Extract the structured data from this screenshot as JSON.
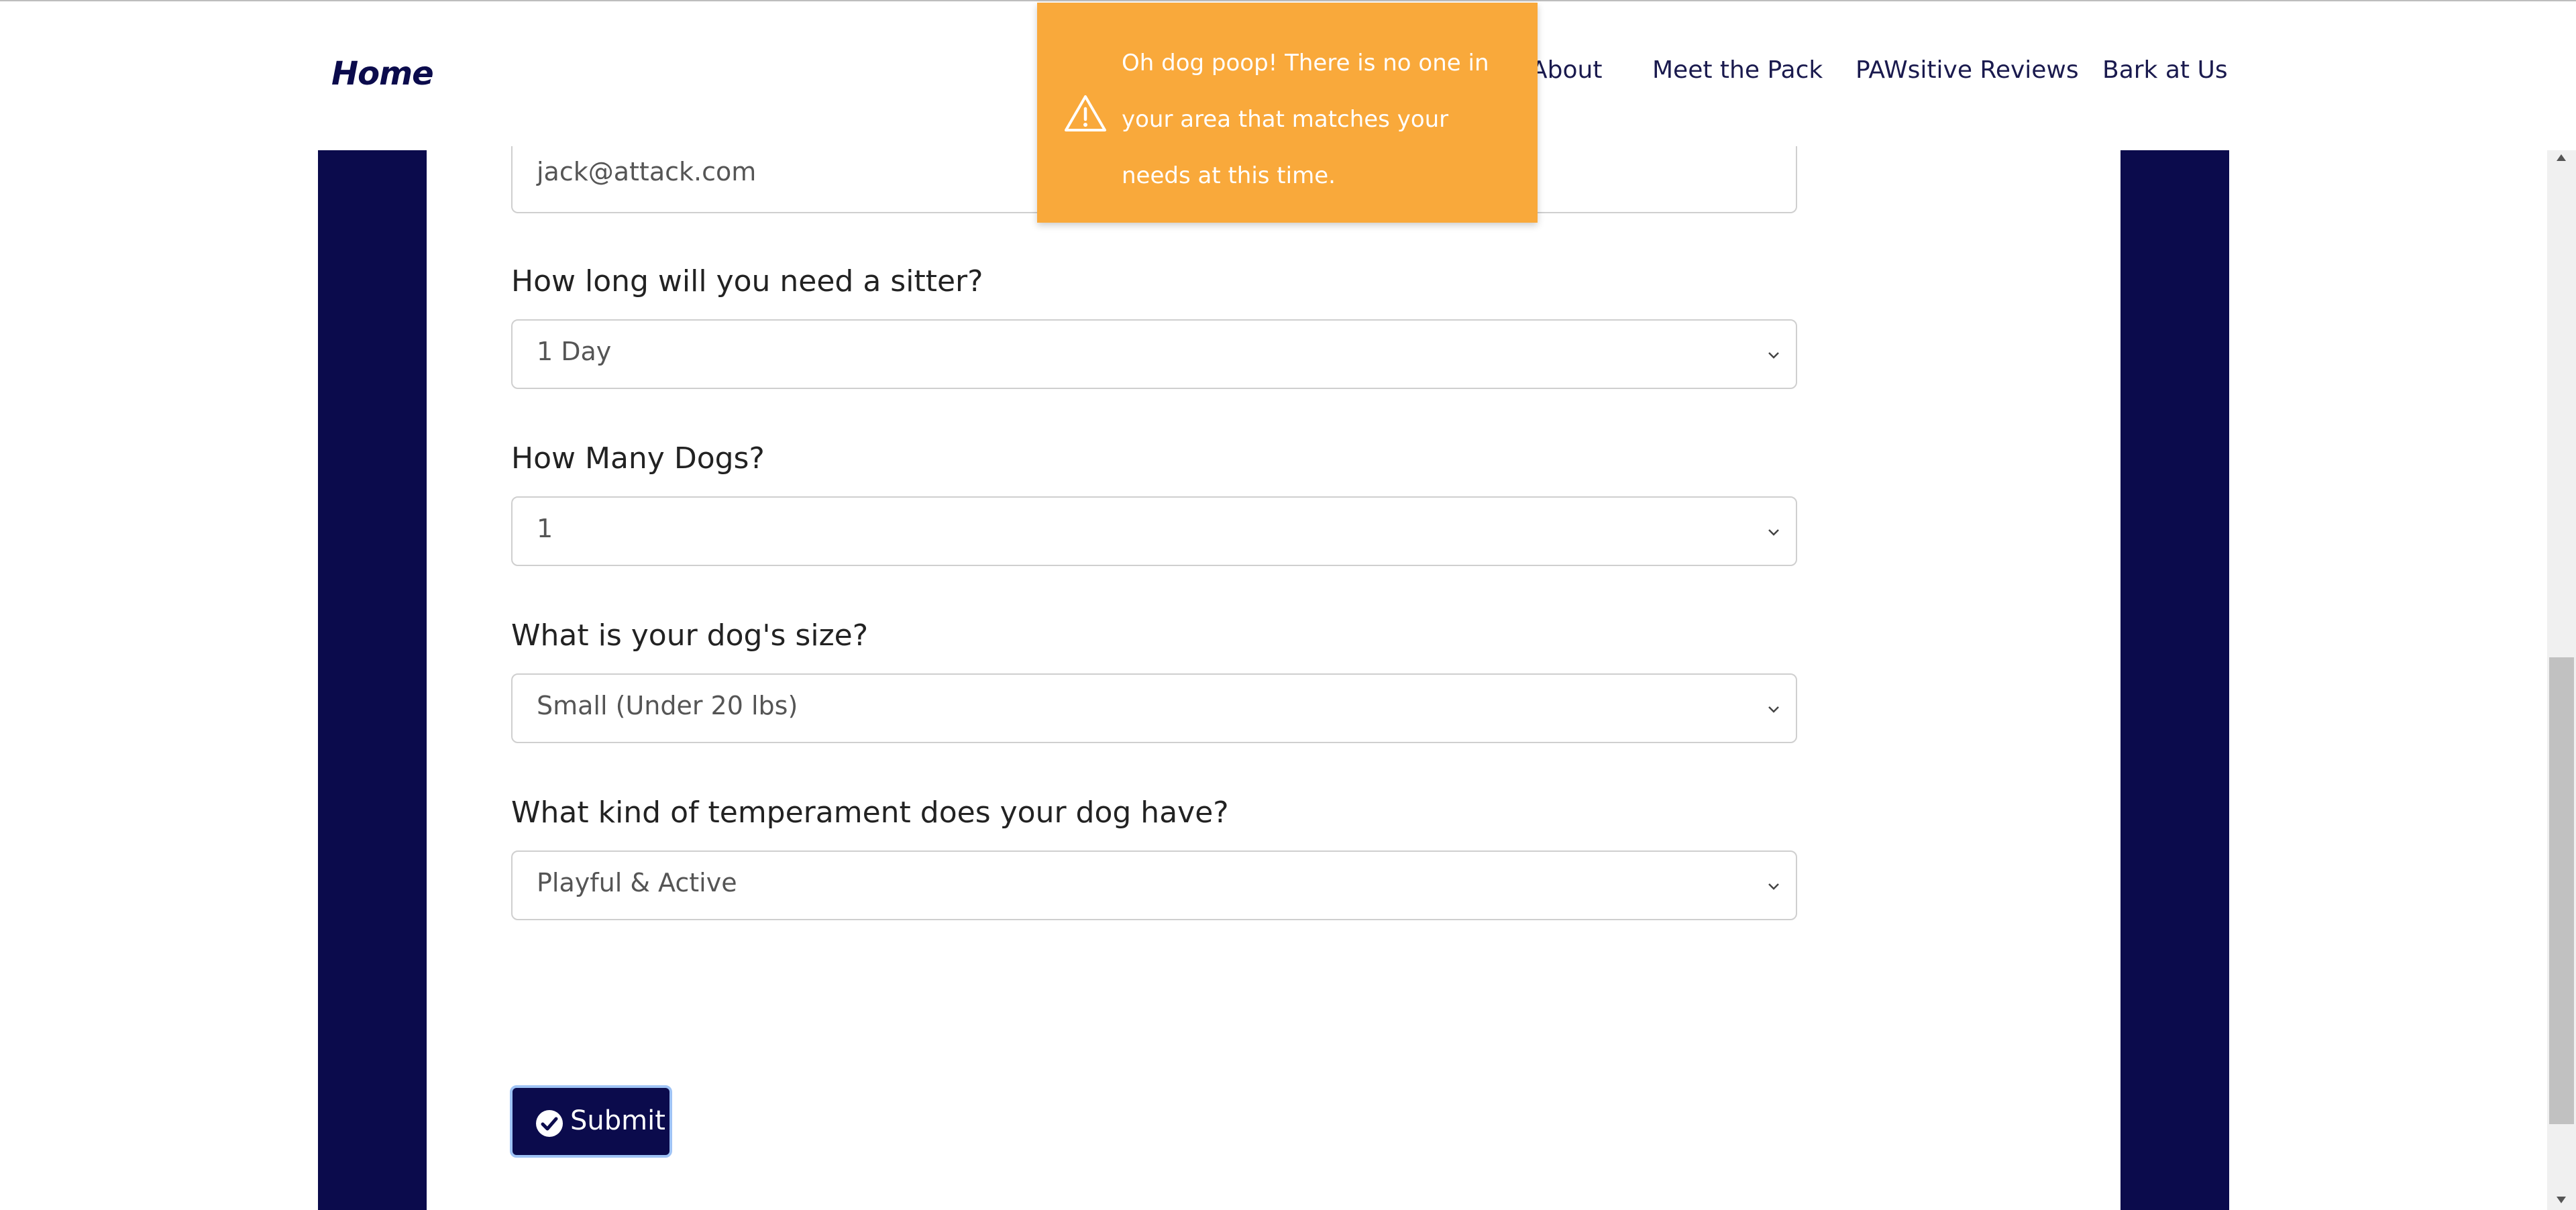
{
  "navbar": {
    "brand": "Home",
    "links": [
      "About",
      "Meet the Pack",
      "PAWsitive Reviews",
      "Bark at Us"
    ]
  },
  "toast": {
    "icon": "warning-icon",
    "message": "Oh dog poop! There is no one in your area that matches your needs at this time.",
    "color": "#f9a93b"
  },
  "form": {
    "email": {
      "value": "jack@attack.com"
    },
    "duration": {
      "label": "How long will you need a sitter?",
      "value": "1 Day"
    },
    "dog_count": {
      "label": "How Many Dogs?",
      "value": "1"
    },
    "dog_size": {
      "label": "What is your dog's size?",
      "value": "Small (Under 20 lbs)"
    },
    "temperament": {
      "label": "What kind of temperament does your dog have?",
      "value": "Playful & Active"
    },
    "submit_label": "Submit",
    "submit_icon": "check-circle-icon"
  },
  "colors": {
    "brand_navy": "#0b0b4c",
    "toast_orange": "#f9a93b",
    "focus_outline": "#9fc3f5"
  }
}
